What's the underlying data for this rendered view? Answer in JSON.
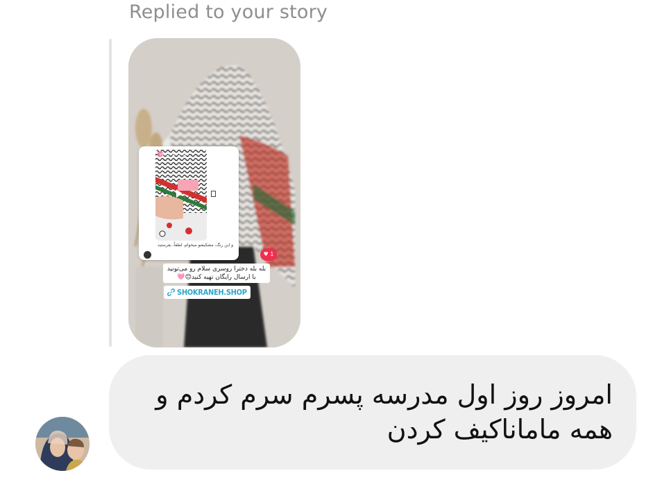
{
  "thread": {
    "replied_label": "Replied to your story",
    "story": {
      "shared_post": {
        "account_handle": "shokraneh.shop",
        "caption": "و این رنگ، مشکیشو میخوام، لطفاً، بفرستید",
        "icon": "play-icon"
      },
      "like_count": "1",
      "text_sticker": "بله بله دخترا روسری سلام رو می‌تونید با ارسال رایگان تهیه کنید😊🩷",
      "link_sticker": {
        "icon": "link-icon",
        "label": "SHOKRANEH.SHOP"
      }
    },
    "message": {
      "text": "امروز روز اول مدرسه پسرم سرم کردم و همه ماماناکیف کردن"
    },
    "avatar": {
      "icon": "user-avatar"
    }
  }
}
